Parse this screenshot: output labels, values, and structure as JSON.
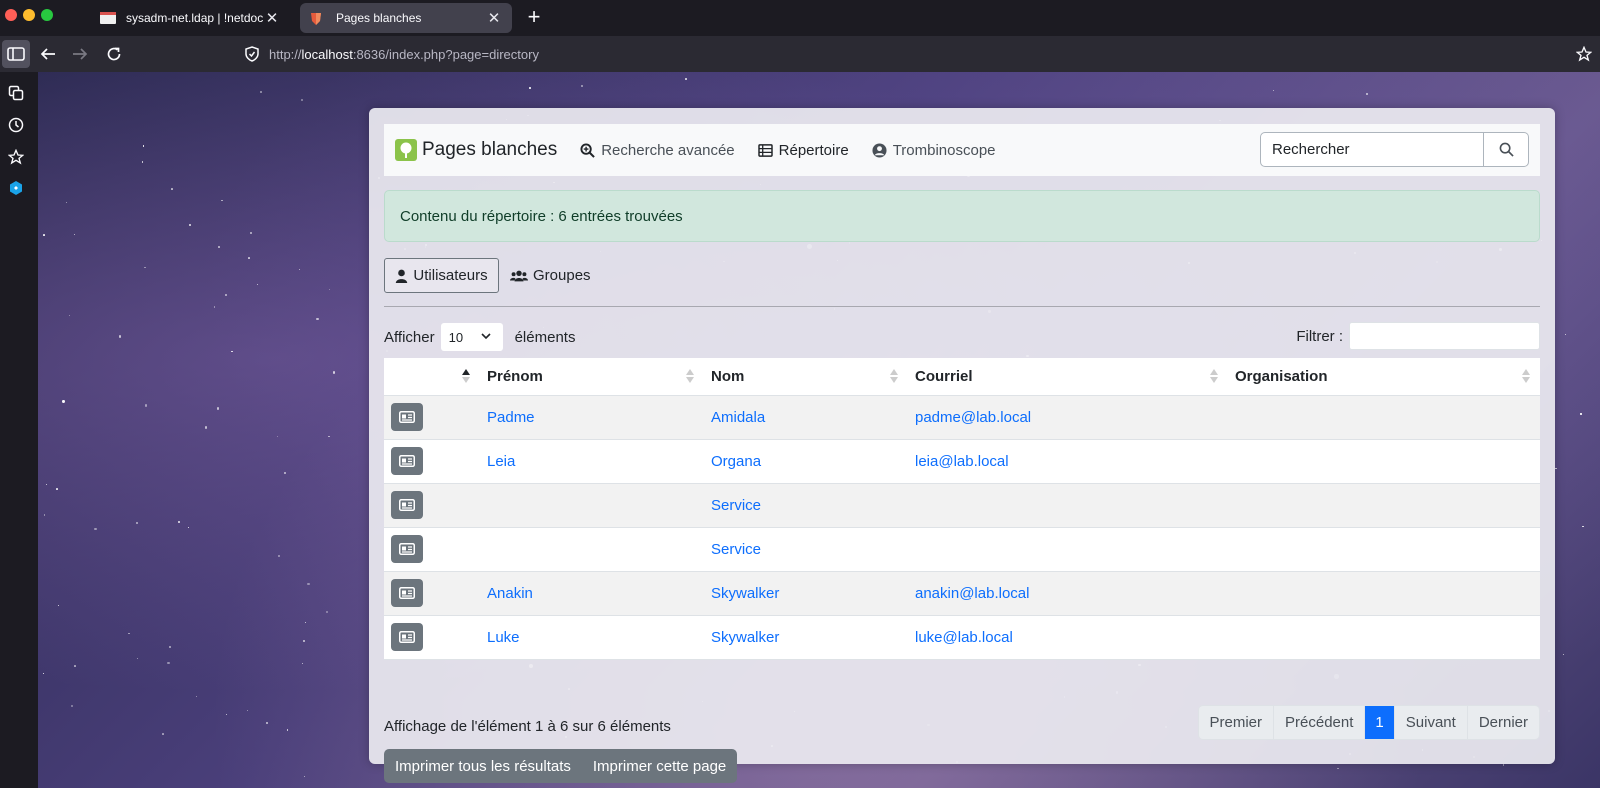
{
  "browser": {
    "tabs": [
      {
        "title": "sysadm-net.ldap | !netdoc.net",
        "active": false
      },
      {
        "title": "Pages blanches",
        "active": true
      }
    ],
    "url": {
      "scheme": "http://",
      "host": "localhost",
      "rest": ":8636/index.php?page=directory"
    }
  },
  "app": {
    "brand": "Pages blanches",
    "nav": [
      {
        "label": "Recherche avancée",
        "icon": "search-plus-icon"
      },
      {
        "label": "Répertoire",
        "icon": "table-list-icon"
      },
      {
        "label": "Trombinoscope",
        "icon": "user-circle-icon"
      }
    ],
    "search": {
      "placeholder": "Rechercher"
    }
  },
  "alert": {
    "text": "Contenu du répertoire : 6 entrées trouvées"
  },
  "tabs": [
    {
      "label": "Utilisateurs",
      "icon": "user-icon",
      "active": true
    },
    {
      "label": "Groupes",
      "icon": "users-icon",
      "active": false
    }
  ],
  "table_controls": {
    "show_label": "Afficher",
    "page_length": "10",
    "elements_label": "éléments",
    "filter_label": "Filtrer :"
  },
  "table": {
    "columns": [
      "",
      "Prénom",
      "Nom",
      "Courriel",
      "Organisation"
    ],
    "rows": [
      {
        "prenom": "Padme",
        "nom": "Amidala",
        "courriel": "padme@lab.local",
        "organisation": ""
      },
      {
        "prenom": "Leia",
        "nom": "Organa",
        "courriel": "leia@lab.local",
        "organisation": ""
      },
      {
        "prenom": "",
        "nom": "Service",
        "courriel": "",
        "organisation": ""
      },
      {
        "prenom": "",
        "nom": "Service",
        "courriel": "",
        "organisation": ""
      },
      {
        "prenom": "Anakin",
        "nom": "Skywalker",
        "courriel": "anakin@lab.local",
        "organisation": ""
      },
      {
        "prenom": "Luke",
        "nom": "Skywalker",
        "courriel": "luke@lab.local",
        "organisation": ""
      }
    ]
  },
  "info": "Affichage de l'élément 1 à 6 sur 6 éléments",
  "pagination": {
    "first": "Premier",
    "prev": "Précédent",
    "current": "1",
    "next": "Suivant",
    "last": "Dernier"
  },
  "print": {
    "all": "Imprimer tous les résultats",
    "page": "Imprimer cette page"
  },
  "colors": {
    "link": "#0d6efd",
    "alert_bg": "#d1e7dd",
    "button_secondary": "#6c757d",
    "page_active": "#0d6efd"
  }
}
